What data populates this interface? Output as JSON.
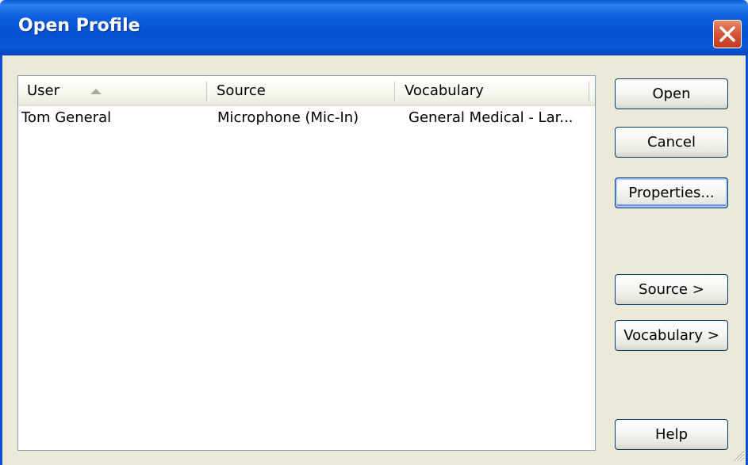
{
  "window": {
    "title": "Open Profile"
  },
  "columns": [
    {
      "label": "User"
    },
    {
      "label": "Source"
    },
    {
      "label": "Vocabulary"
    }
  ],
  "rows": [
    {
      "user": "Tom General",
      "source": "Microphone (Mic-In)",
      "vocabulary": "General Medical - Lar..."
    }
  ],
  "buttons": {
    "open": "Open",
    "cancel": "Cancel",
    "properties": "Properties...",
    "source": "Source >",
    "vocabulary": "Vocabulary >",
    "help": "Help"
  },
  "icons": {
    "close": "close-icon",
    "sort": "sort-ascending-icon",
    "grip": "resize-grip-icon"
  },
  "colors": {
    "titlebar": "#0651d1",
    "close": "#d8573a",
    "dialog_bg": "#ece9d8"
  }
}
